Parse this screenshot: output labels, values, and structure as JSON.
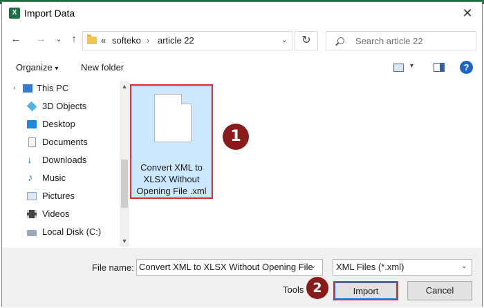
{
  "window": {
    "title": "Import Data",
    "app_icon_letter": "X",
    "close_glyph": "✕"
  },
  "nav": {
    "back_glyph": "←",
    "forward_glyph": "→",
    "dropdown_glyph": "⌄",
    "up_glyph": "↑"
  },
  "address": {
    "overflow": "«",
    "crumbs": [
      "softeko",
      "article 22"
    ],
    "separator": "›",
    "dropdown_glyph": "⌄",
    "refresh_glyph": "↻"
  },
  "search": {
    "placeholder": "Search article 22"
  },
  "toolbar": {
    "organize_label": "Organize",
    "organize_arrow": "▾",
    "new_folder_label": "New folder",
    "view_arrow": "▾",
    "help_glyph": "?"
  },
  "sidebar": {
    "items": [
      {
        "label": "This PC",
        "icon": "computer-icon",
        "color": "#3a7bd5"
      },
      {
        "label": "3D Objects",
        "icon": "cube-icon",
        "color": "#52b4e6"
      },
      {
        "label": "Desktop",
        "icon": "desktop-icon",
        "color": "#1e88e5"
      },
      {
        "label": "Documents",
        "icon": "documents-icon",
        "color": "#8a9bb0"
      },
      {
        "label": "Downloads",
        "icon": "download-icon",
        "color": "#1e6fd9"
      },
      {
        "label": "Music",
        "icon": "music-icon",
        "color": "#1e6fd9"
      },
      {
        "label": "Pictures",
        "icon": "pictures-icon",
        "color": "#8aa4c4"
      },
      {
        "label": "Videos",
        "icon": "videos-icon",
        "color": "#444444"
      },
      {
        "label": "Local Disk (C:)",
        "icon": "drive-icon",
        "color": "#9aa8b8"
      }
    ],
    "expand_glyph": "›",
    "scroll_up_glyph": "▲",
    "scroll_down_glyph": "▼"
  },
  "files": [
    {
      "name": "Convert XML to XLSX Without Opening File .xml",
      "icon": "xml-file-icon",
      "selected": true
    }
  ],
  "callouts": [
    "1",
    "2"
  ],
  "footer": {
    "file_name_label": "File name:",
    "file_name_value": "Convert XML to XLSX Without Opening File",
    "file_type_value": "XML Files (*.xml)",
    "dropdown_glyph": "⌄",
    "tools_label": "Tools",
    "tools_arrow": "▾",
    "import_label": "Import",
    "cancel_label": "Cancel"
  },
  "colors": {
    "selection_fill": "#cce8ff",
    "highlight_border": "#dd3333",
    "callout_fill": "#8b1a1a",
    "excel_green": "#1d6f42"
  }
}
